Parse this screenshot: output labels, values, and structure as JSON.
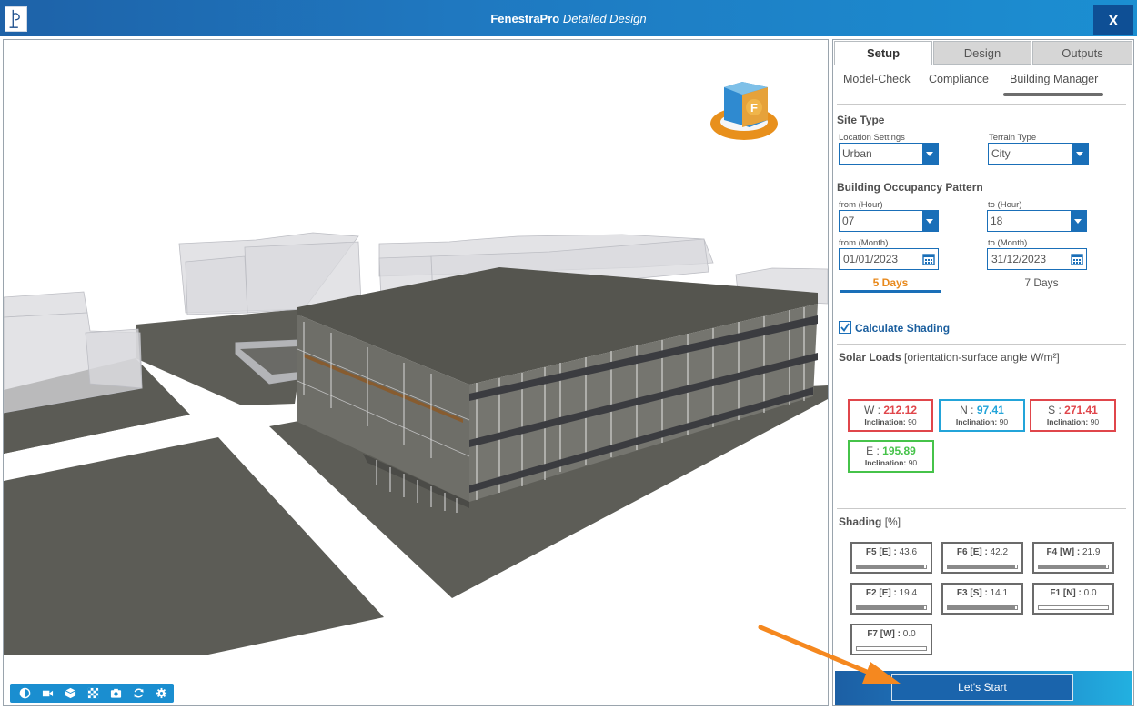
{
  "window": {
    "title_bold": "FenestraPro",
    "title_italic": "Detailed Design",
    "close_label": "X"
  },
  "tabs": [
    {
      "label": "Setup",
      "active": true
    },
    {
      "label": "Design",
      "active": false
    },
    {
      "label": "Outputs",
      "active": false
    }
  ],
  "subtabs": [
    {
      "label": "Model-Check"
    },
    {
      "label": "Compliance"
    },
    {
      "label": "Building Manager"
    }
  ],
  "site_type": {
    "title": "Site Type",
    "location_label": "Location Settings",
    "location_value": "Urban",
    "terrain_label": "Terrain Type",
    "terrain_value": "City"
  },
  "occupancy": {
    "title": "Building Occupancy Pattern",
    "from_hour_label": "from (Hour)",
    "from_hour_value": "07",
    "to_hour_label": "to (Hour)",
    "to_hour_value": "18",
    "from_month_label": "from (Month)",
    "from_month_value": "01/01/2023",
    "to_month_label": "to (Month)",
    "to_month_value": "31/12/2023",
    "days_5": "5 Days",
    "days_7": "7 Days"
  },
  "shading_toggle": {
    "label": "Calculate Shading",
    "checked": true
  },
  "solar_loads": {
    "title": "Solar Loads",
    "subtitle": "[orientation-surface angle W/m²]",
    "cards": [
      {
        "dir": "W :",
        "value": "212.12",
        "incl_label": "Inclination:",
        "incl_value": "90",
        "color": "#e0464b"
      },
      {
        "dir": "N :",
        "value": "97.41",
        "incl_label": "Inclination:",
        "incl_value": "90",
        "color": "#23a4d9"
      },
      {
        "dir": "S :",
        "value": "271.41",
        "incl_label": "Inclination:",
        "incl_value": "90",
        "color": "#e0464b"
      },
      {
        "dir": "E :",
        "value": "195.89",
        "incl_label": "Inclination:",
        "incl_value": "90",
        "color": "#46c34a"
      }
    ]
  },
  "shading": {
    "title": "Shading",
    "unit": "[%]",
    "cards": [
      {
        "label": "F5 [E] :",
        "value": "43.6",
        "fraction": 0.97
      },
      {
        "label": "F6 [E] :",
        "value": "42.2",
        "fraction": 0.97
      },
      {
        "label": "F4 [W] :",
        "value": "21.9",
        "fraction": 0.97
      },
      {
        "label": "F2 [E] :",
        "value": "19.4",
        "fraction": 0.97
      },
      {
        "label": "F3 [S] :",
        "value": "14.1",
        "fraction": 0.97
      },
      {
        "label": "F1 [N] :",
        "value": "0.0",
        "fraction": 0.0
      },
      {
        "label": "F7 [W] :",
        "value": "0.0",
        "fraction": 0.0
      }
    ]
  },
  "start_button": "Let's Start",
  "nav_cube_letter": "F",
  "toolbar_icons": [
    "contrast-icon",
    "camera-icon",
    "cube-icon",
    "checker-icon",
    "screenshot-icon",
    "refresh-icon",
    "gear-icon"
  ],
  "colors": {
    "accent_blue": "#1a6fb8",
    "active_orange": "#e8891c",
    "arrow_orange": "#f5881f"
  }
}
